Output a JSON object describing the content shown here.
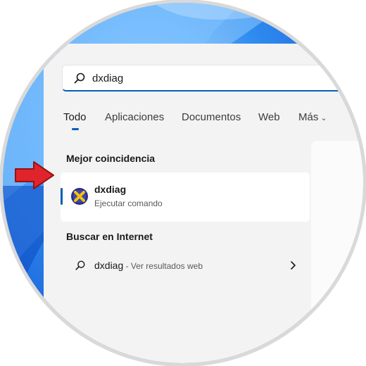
{
  "search": {
    "query": "dxdiag",
    "icon": "search-icon"
  },
  "tabs": [
    {
      "label": "Todo",
      "active": true
    },
    {
      "label": "Aplicaciones"
    },
    {
      "label": "Documentos"
    },
    {
      "label": "Web"
    },
    {
      "label": "Más",
      "icon": "chevron-down-icon"
    }
  ],
  "best_match": {
    "heading": "Mejor coincidencia",
    "name": "dxdiag",
    "subtitle": "Ejecutar comando",
    "icon": "directx-diagnostic-icon"
  },
  "internet": {
    "heading": "Buscar en Internet",
    "query": "dxdiag",
    "suffix": " - Ver resultados web",
    "icon": "search-icon"
  },
  "colors": {
    "accent": "#005fb8",
    "pointer_arrow": "#e0242c"
  }
}
